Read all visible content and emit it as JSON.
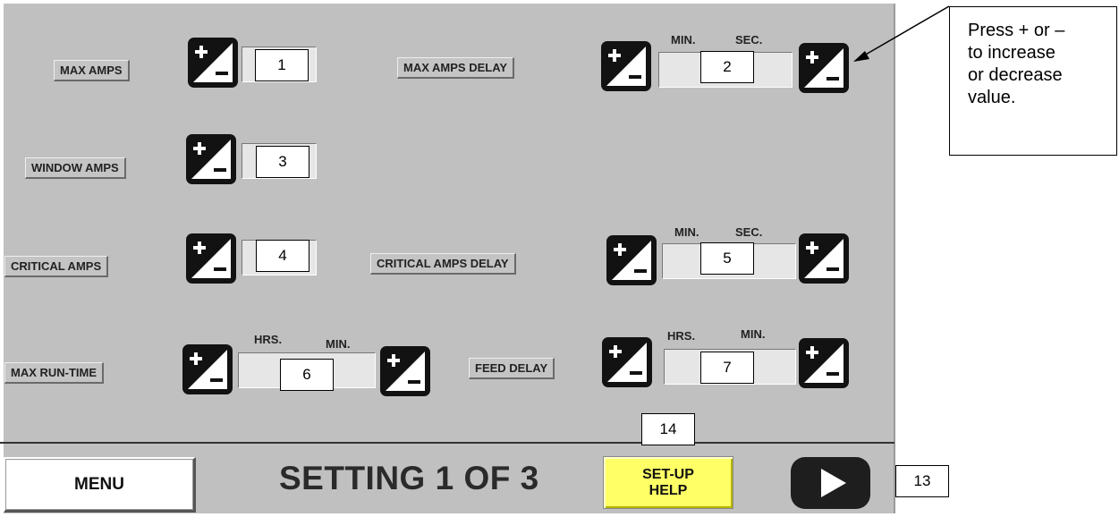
{
  "footer": {
    "menu_label": "MENU",
    "title": "SETTING 1 OF 3",
    "help_line1": "SET-UP",
    "help_line2": "HELP",
    "next_icon": "play-arrow-icon"
  },
  "settings": {
    "max_amps": "MAX AMPS",
    "window_amps": "WINDOW AMPS",
    "critical_amps": "CRITICAL AMPS",
    "max_run_time": "MAX RUN-TIME",
    "max_amps_delay": "MAX AMPS  DELAY",
    "critical_amps_delay": "CRITICAL AMPS DELAY",
    "feed_delay": "FEED DELAY"
  },
  "units": {
    "min": "MIN.",
    "sec": "SEC.",
    "hrs": "HRS."
  },
  "markers": [
    "1",
    "2",
    "3",
    "4",
    "5",
    "6",
    "7",
    "13",
    "14"
  ],
  "callout": {
    "text_line1": "Press + or –",
    "text_line2": "to increase",
    "text_line3": "or decrease",
    "text_line4": "value."
  },
  "icons": [
    "plus-minus-icon",
    "play-arrow-icon",
    "callout-arrow-icon"
  ],
  "colors": {
    "panel": "#c0c0c0",
    "help_button": "#ffff66",
    "button_dark": "#121212"
  }
}
